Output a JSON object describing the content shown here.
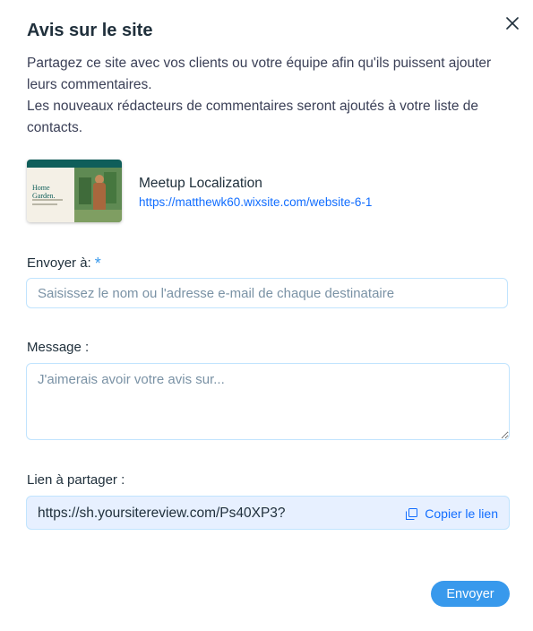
{
  "dialog": {
    "title": "Avis sur le site",
    "description_line1": "Partagez ce site avec vos clients ou votre équipe afin qu'ils puissent ajouter leurs commentaires.",
    "description_line2": "Les nouveaux rédacteurs de commentaires seront ajoutés à votre liste de contacts.",
    "close_icon": "close-icon"
  },
  "site": {
    "name": "Meetup Localization",
    "url": "https://matthewk60.wixsite.com/website-6-1",
    "thumbnail_text": "Home Garden."
  },
  "recipients": {
    "label": "Envoyer à:",
    "required_mark": "*",
    "placeholder": "Saisissez le nom ou l'adresse e-mail de chaque destinataire",
    "value": ""
  },
  "message": {
    "label": "Message :",
    "placeholder": "J'aimerais avoir votre avis sur...",
    "value": ""
  },
  "share_link": {
    "label": "Lien à partager :",
    "url": "https://sh.yoursitereview.com/Ps40XP3?",
    "copy_label": "Copier le lien",
    "copy_icon": "copy-icon"
  },
  "actions": {
    "send_label": "Envoyer"
  },
  "colors": {
    "accent": "#116dff",
    "button": "#3899ec",
    "link_box_bg": "#e7f0ff",
    "input_border": "#c1e4fe"
  }
}
